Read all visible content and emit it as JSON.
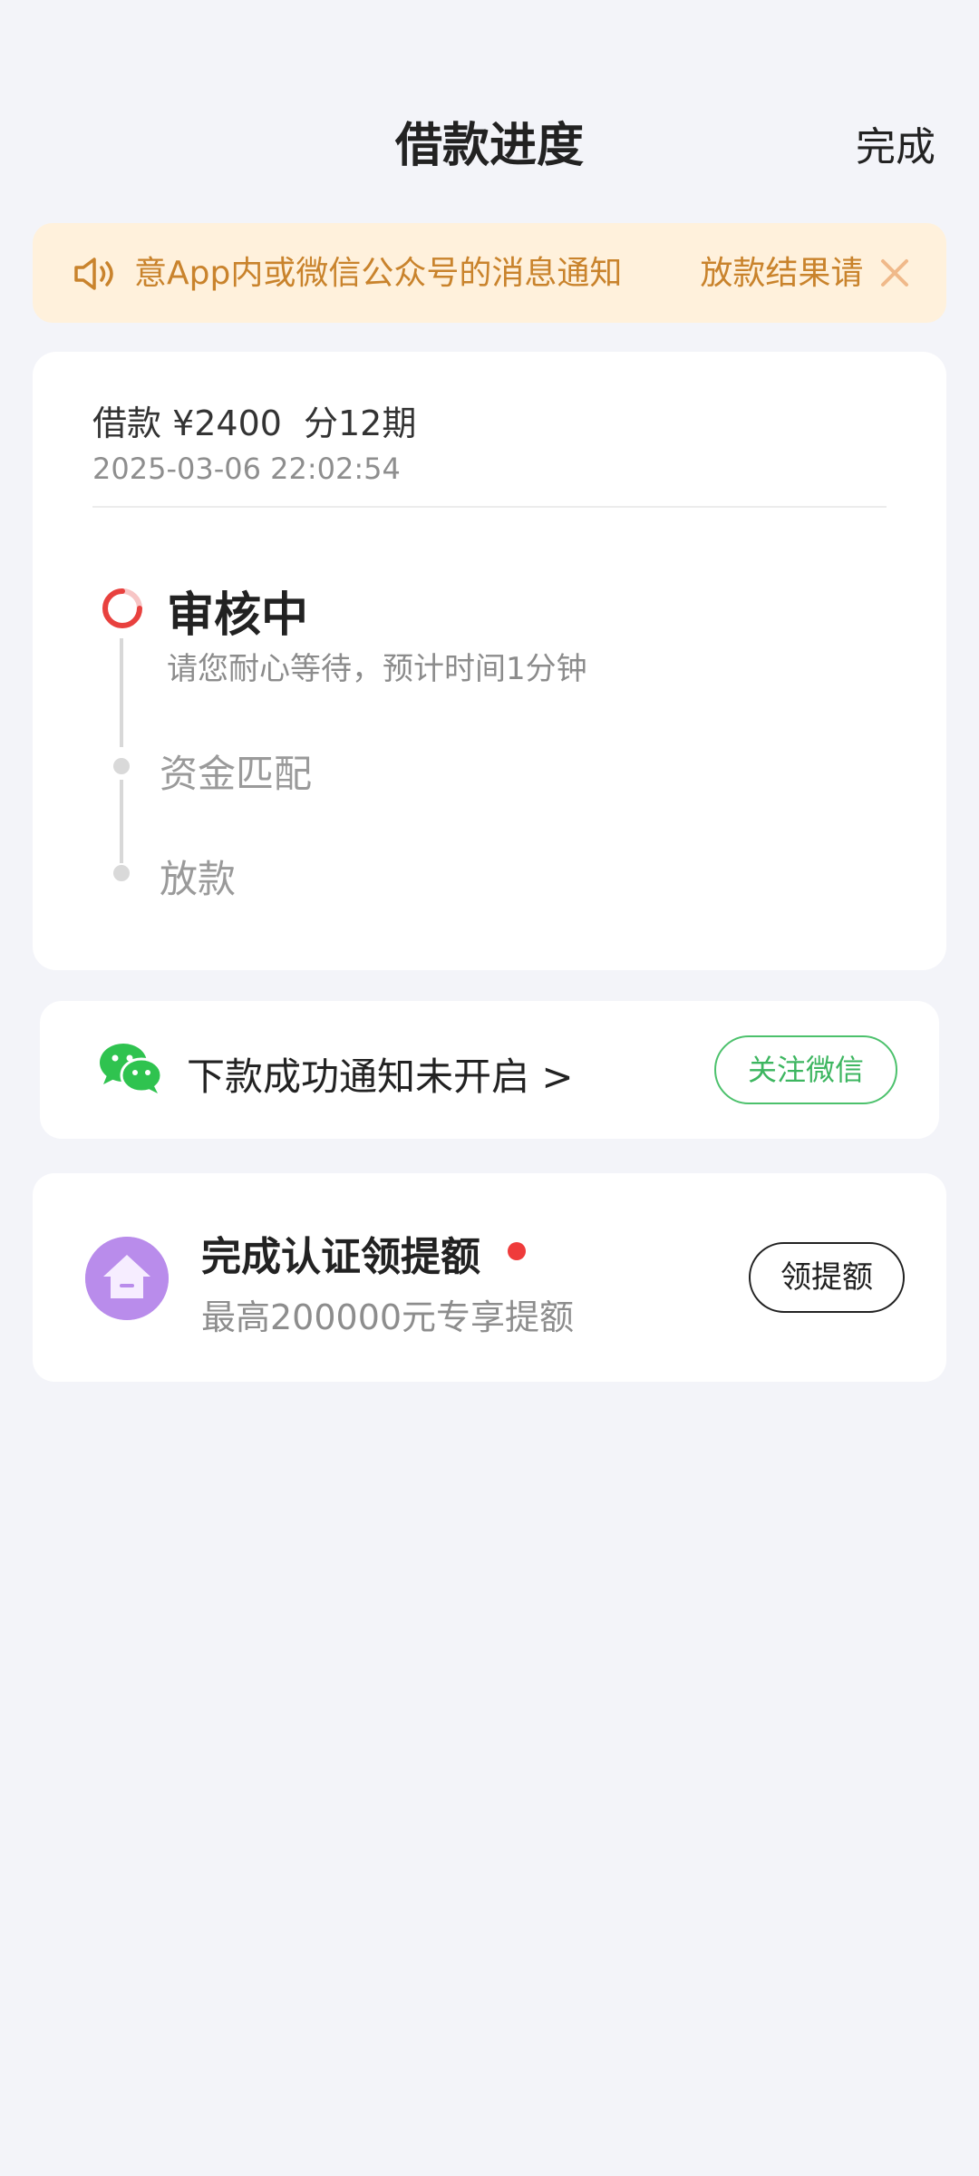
{
  "header": {
    "title": "借款进度",
    "done_label": "完成"
  },
  "notice": {
    "text_part1": "意App内或微信公众号的消息通知",
    "text_part2": "放款结果请",
    "icon": "speaker-icon",
    "close_icon": "close-icon",
    "color": "#c9832c"
  },
  "loan": {
    "amount_label": "借款 ¥2400",
    "term_label": "分12期",
    "datetime": "2025-03-06 22:02:54"
  },
  "steps": {
    "active": {
      "title": "审核中",
      "description": "请您耐心等待，预计时间1分钟"
    },
    "items": [
      {
        "title": "资金匹配"
      },
      {
        "title": "放款"
      }
    ]
  },
  "wechat": {
    "icon": "wechat-icon",
    "text": "下款成功通知未开启 >",
    "button_label": "关注微信",
    "accent": "#3db660"
  },
  "cert": {
    "icon": "house-icon",
    "title": "完成认证领提额",
    "subtitle": "最高200000元专享提额",
    "button_label": "领提额",
    "badge_color": "#ef3b3b"
  }
}
